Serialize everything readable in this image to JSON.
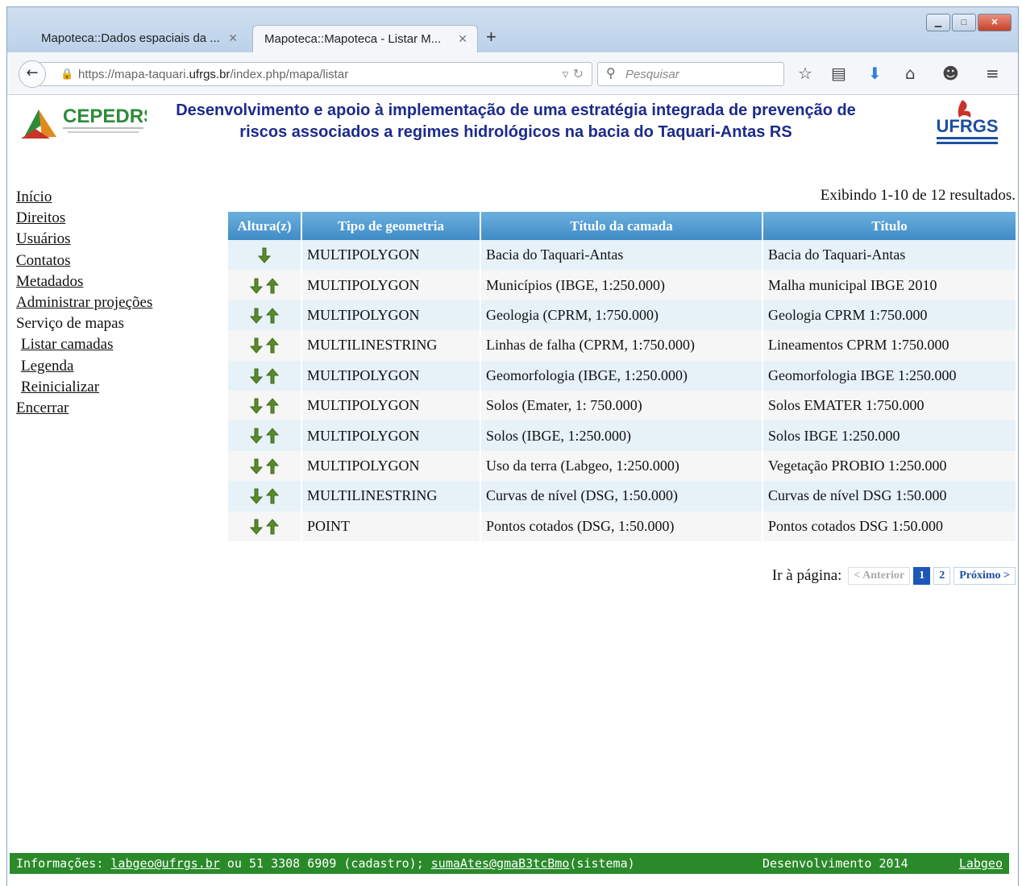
{
  "browser": {
    "tabs": [
      {
        "label": "Mapoteca::Dados espaciais da ...",
        "active": false
      },
      {
        "label": "Mapoteca::Mapoteca - Listar M...",
        "active": true
      }
    ],
    "new_tab": "+",
    "url_prefix": "https://mapa-taquari.",
    "url_domain": "ufrgs.br",
    "url_path": "/index.php/mapa/listar",
    "search_placeholder": "Pesquisar"
  },
  "header": {
    "cepedrs_logo_text": "CEPEDRS",
    "ufrgs_logo_text": "UFRGS",
    "title_line1": "Desenvolvimento e apoio à implementação de uma estratégia integrada de prevenção de",
    "title_line2": "riscos associados a regimes hidrológicos na bacia do Taquari-Antas RS"
  },
  "sidebar": {
    "items": [
      {
        "label": "Início",
        "link": true
      },
      {
        "label": "Direitos",
        "link": true
      },
      {
        "label": "Usuários",
        "link": true
      },
      {
        "label": "Contatos",
        "link": true
      },
      {
        "label": "Metadados",
        "link": true
      },
      {
        "label": "Administrar projeções",
        "link": true
      },
      {
        "label": "Serviço de mapas",
        "link": false
      },
      {
        "label": "Listar camadas",
        "link": true,
        "sub": true
      },
      {
        "label": "Legenda",
        "link": true,
        "sub": true
      },
      {
        "label": "Reinicializar",
        "link": true,
        "sub": true
      },
      {
        "label": "Encerrar",
        "link": true
      }
    ]
  },
  "results": {
    "summary": "Exibindo 1-10 de 12 resultados.",
    "columns": [
      "Altura(z)",
      "Tipo de geometria",
      "Título da camada",
      "Título"
    ],
    "rows": [
      {
        "arrows": "down",
        "tipo": "MULTIPOLYGON",
        "titulo_camada": "Bacia do Taquari-Antas",
        "titulo": "Bacia do Taquari-Antas"
      },
      {
        "arrows": "both",
        "tipo": "MULTIPOLYGON",
        "titulo_camada": "Municípios (IBGE, 1:250.000)",
        "titulo": "Malha municipal IBGE 2010"
      },
      {
        "arrows": "both",
        "tipo": "MULTIPOLYGON",
        "titulo_camada": "Geologia (CPRM, 1:750.000)",
        "titulo": "Geologia CPRM 1:750.000"
      },
      {
        "arrows": "both",
        "tipo": "MULTILINESTRING",
        "titulo_camada": "Linhas de falha (CPRM, 1:750.000)",
        "titulo": "Lineamentos CPRM 1:750.000"
      },
      {
        "arrows": "both",
        "tipo": "MULTIPOLYGON",
        "titulo_camada": "Geomorfologia (IBGE, 1:250.000)",
        "titulo": "Geomorfologia IBGE 1:250.000"
      },
      {
        "arrows": "both",
        "tipo": "MULTIPOLYGON",
        "titulo_camada": "Solos (Emater, 1: 750.000)",
        "titulo": "Solos EMATER 1:750.000"
      },
      {
        "arrows": "both",
        "tipo": "MULTIPOLYGON",
        "titulo_camada": "Solos (IBGE, 1:250.000)",
        "titulo": "Solos IBGE 1:250.000"
      },
      {
        "arrows": "both",
        "tipo": "MULTIPOLYGON",
        "titulo_camada": "Uso da terra (Labgeo, 1:250.000)",
        "titulo": "Vegetação PROBIO 1:250.000"
      },
      {
        "arrows": "both",
        "tipo": "MULTILINESTRING",
        "titulo_camada": "Curvas de nível (DSG, 1:50.000)",
        "titulo": "Curvas de nível DSG 1:50.000"
      },
      {
        "arrows": "both",
        "tipo": "POINT",
        "titulo_camada": "Pontos cotados (DSG, 1:50.000)",
        "titulo": "Pontos cotados DSG 1:50.000"
      }
    ]
  },
  "pager": {
    "label": "Ir à página:",
    "prev": "< Anterior",
    "pages": [
      "1",
      "2"
    ],
    "current": "1",
    "next": "Próximo >"
  },
  "footer": {
    "info_label": "Informações:",
    "email1": "labgeo@ufrgs.br",
    "phone_text": "ou 51 3308 6909 (cadastro);",
    "email2": "sumaAtes@gmaB3tcBmo",
    "system_text": "(sistema)",
    "dev_text": "Desenvolvimento 2014",
    "dev_link": "Labgeo"
  },
  "colors": {
    "header_title": "#1c2b8a",
    "table_header": "#4d9ad2",
    "footer_bg": "#2a8a2a",
    "arrow_green": "#5a8a2a"
  }
}
